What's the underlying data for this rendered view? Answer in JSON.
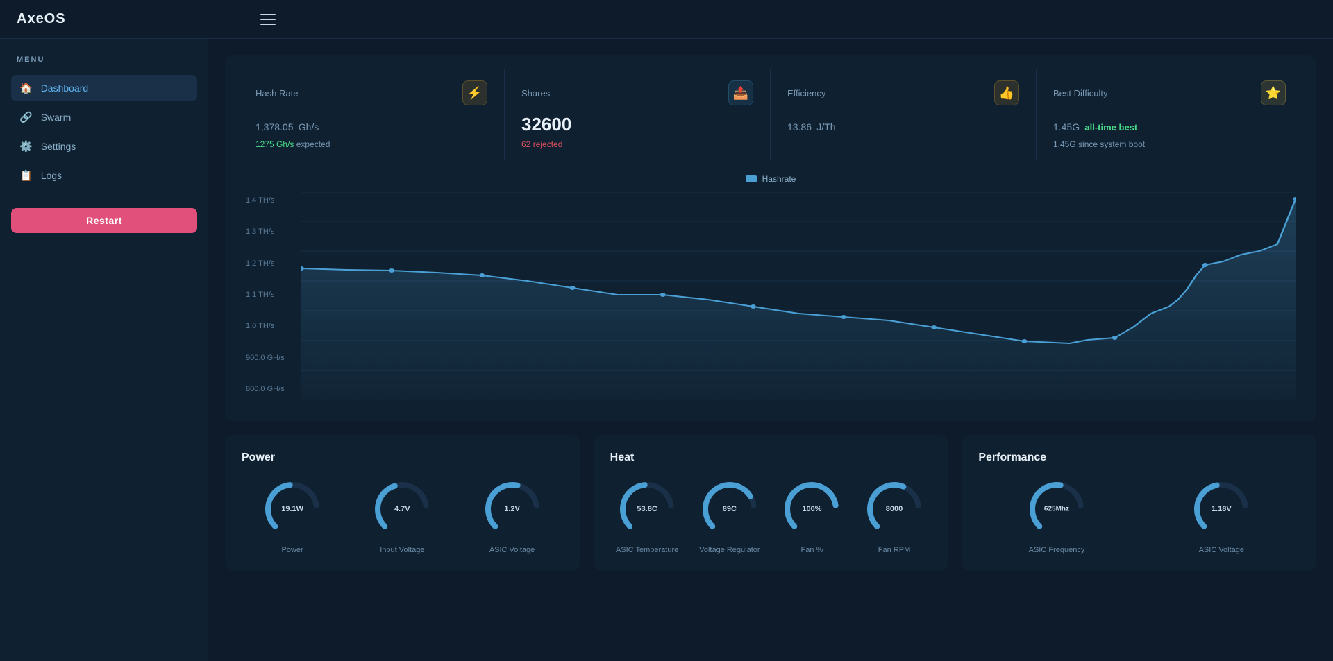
{
  "app": {
    "title": "AxeOS"
  },
  "sidebar": {
    "menu_label": "MENU",
    "items": [
      {
        "id": "dashboard",
        "label": "Dashboard",
        "icon": "🏠",
        "active": true
      },
      {
        "id": "swarm",
        "label": "Swarm",
        "icon": "🔗",
        "active": false
      },
      {
        "id": "settings",
        "label": "Settings",
        "icon": "⚙️",
        "active": false
      },
      {
        "id": "logs",
        "label": "Logs",
        "icon": "📋",
        "active": false
      }
    ],
    "restart_label": "Restart"
  },
  "stats": {
    "hash_rate": {
      "title": "Hash Rate",
      "value": "1,378.05",
      "unit": "Gh/s",
      "sub_value": "1275 Gh/s",
      "sub_text": "expected",
      "icon": "⚡",
      "icon_class": "orange"
    },
    "shares": {
      "title": "Shares",
      "value": "32600",
      "rejected_count": "62",
      "rejected_label": "rejected",
      "icon": "📤",
      "icon_class": "blue"
    },
    "efficiency": {
      "title": "Efficiency",
      "value": "13.86",
      "unit": "J/Th",
      "icon": "👍",
      "icon_class": "orange"
    },
    "best_difficulty": {
      "title": "Best Difficulty",
      "value": "1.45G",
      "badge": "all-time best",
      "sub_value": "1.45G",
      "sub_text": "since system boot",
      "icon": "⭐",
      "icon_class": "yellow"
    }
  },
  "chart": {
    "legend_label": "Hashrate",
    "y_labels": [
      "1.4 TH/s",
      "1.3 TH/s",
      "1.2 TH/s",
      "1.1 TH/s",
      "1.0 TH/s",
      "900.0 GH/s",
      "800.0 GH/s"
    ]
  },
  "power_panel": {
    "title": "Power",
    "gauges": [
      {
        "label": "Power",
        "value": "19.1W",
        "percent": 55,
        "color": "#4a9fd5"
      },
      {
        "label": "Input Voltage",
        "value": "4.7V",
        "percent": 48,
        "color": "#4a9fd5"
      },
      {
        "label": "ASIC Voltage",
        "value": "1.2V",
        "percent": 62,
        "color": "#4a9fd5"
      }
    ]
  },
  "heat_panel": {
    "title": "Heat",
    "gauges": [
      {
        "label": "ASIC Temperature",
        "value": "53.8C",
        "percent": 54,
        "color": "#4a9fd5"
      },
      {
        "label": "Voltage Regulator",
        "value": "89C",
        "percent": 89,
        "color": "#4a9fd5"
      },
      {
        "label": "Fan %",
        "value": "100%",
        "percent": 100,
        "color": "#4a9fd5"
      },
      {
        "label": "Fan RPM",
        "value": "8000",
        "percent": 80,
        "color": "#4a9fd5"
      }
    ]
  },
  "performance_panel": {
    "title": "Performance",
    "gauges": [
      {
        "label": "ASIC Frequency",
        "value": "625Mhz",
        "percent": 62,
        "color": "#4a9fd5"
      },
      {
        "label": "ASIC Voltage",
        "value": "1.18V",
        "percent": 59,
        "color": "#4a9fd5"
      }
    ]
  }
}
